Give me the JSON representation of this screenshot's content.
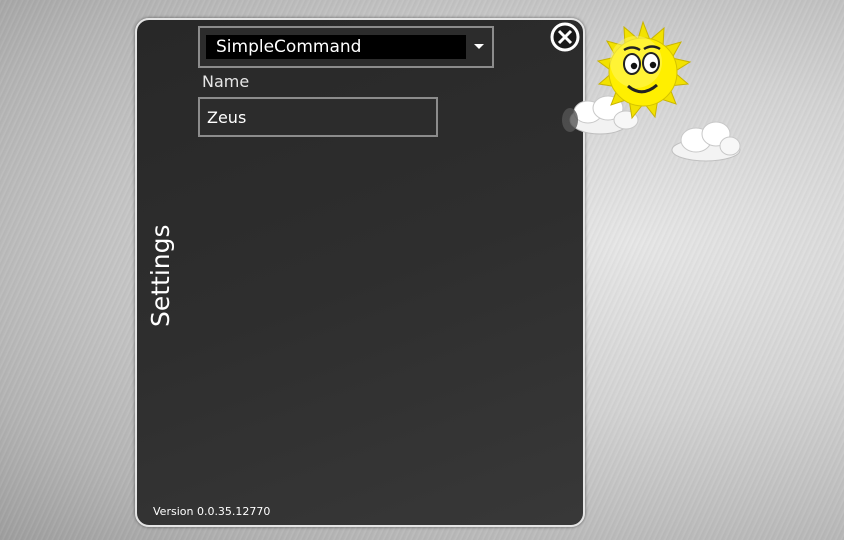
{
  "panel": {
    "title": "Settings",
    "combo": {
      "selected": "SimpleCommand"
    },
    "name_label": "Name",
    "name_value": "Zeus",
    "version": "Version 0.0.35.12770"
  },
  "icons": {
    "close": "close-icon",
    "combo_arrow": "chevron-down-icon",
    "sun": "sun-icon",
    "cloud": "cloud-icon"
  },
  "colors": {
    "panel_bg": "#2e2e2e",
    "panel_border": "#e4e4e4",
    "field_border": "#8c8c8c",
    "sun": "#ffee00"
  }
}
